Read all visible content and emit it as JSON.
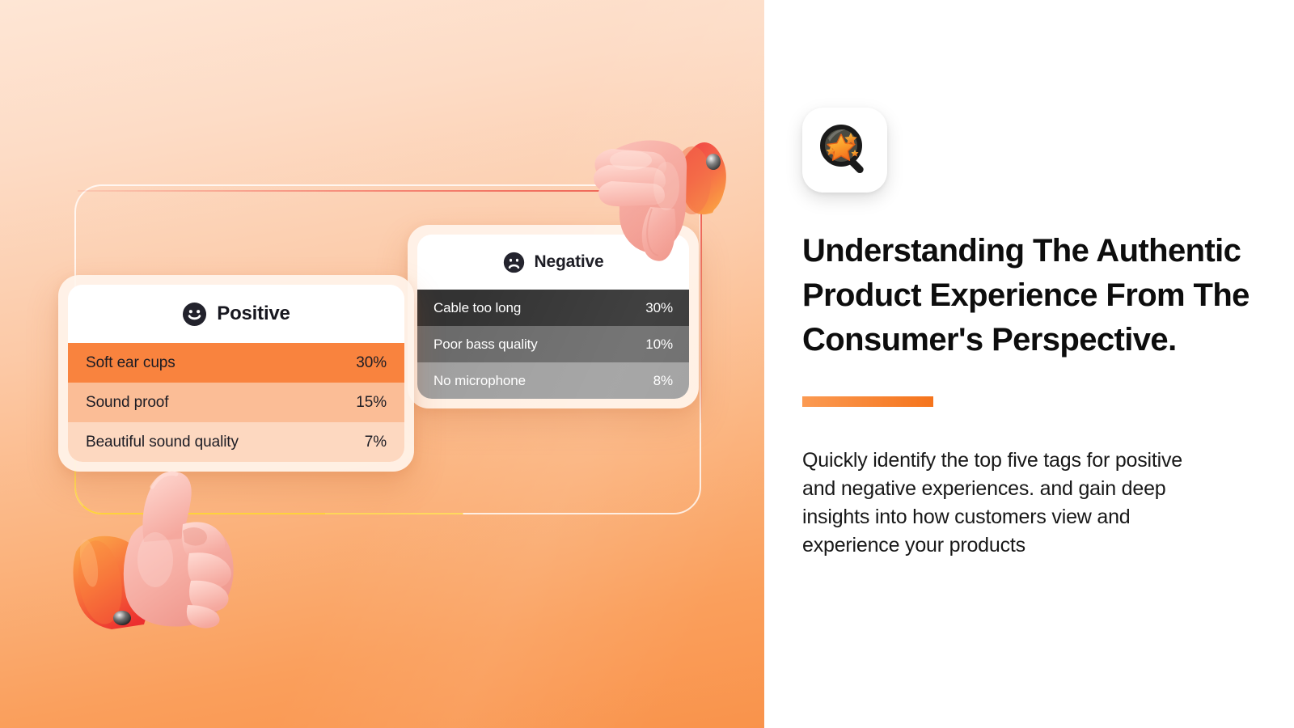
{
  "theme": {
    "bg_top": "#FEE6D5",
    "bg_bottom": "#F9934B",
    "accent": "#F5741C",
    "accent_light": "#FB9A52",
    "panel_bg": "#FFFFFF",
    "card_bg": "#FFF4EC",
    "dark_row": "#333333",
    "text_dark": "#0D0D0D"
  },
  "right_panel": {
    "app_icon_name": "magnifier-star-icon",
    "headline": "Understanding The Authentic Product Experience From The Consumer's Perspective.",
    "body": "Quickly identify the top five tags for positive and negative experiences. and gain deep insights into how customers view and experience your products"
  },
  "visual": {
    "thumbs_up_icon": "thumbs-up-3d-icon",
    "thumbs_down_icon": "thumbs-down-3d-icon",
    "frame_label": "rounded-frame-outline"
  },
  "chart_data": [
    {
      "type": "bar",
      "title": "Positive",
      "icon": "smiley-face-icon",
      "sentiment": "positive",
      "categories": [
        "Soft ear cups",
        "Sound proof",
        "Beautiful sound quality"
      ],
      "values": [
        30,
        15,
        7
      ],
      "value_labels": [
        "30%",
        "15%",
        "7%"
      ],
      "unit": "%",
      "row_colors": [
        "#F9833E",
        "#FBBD96",
        "#FDD8C0"
      ],
      "text_color": "#1C1C24",
      "xlabel": "",
      "ylabel": "",
      "ylim": [
        0,
        30
      ]
    },
    {
      "type": "bar",
      "title": "Negative",
      "icon": "sad-face-icon",
      "sentiment": "negative",
      "categories": [
        "Cable too long",
        "Poor bass quality",
        "No microphone"
      ],
      "values": [
        30,
        10,
        8
      ],
      "value_labels": [
        "30%",
        "10%",
        "8%"
      ],
      "unit": "%",
      "row_colors": [
        "#333333",
        "#6B6B6B",
        "#A0A0A0"
      ],
      "text_color": "#FFFFFF",
      "xlabel": "",
      "ylabel": "",
      "ylim": [
        0,
        30
      ]
    }
  ]
}
